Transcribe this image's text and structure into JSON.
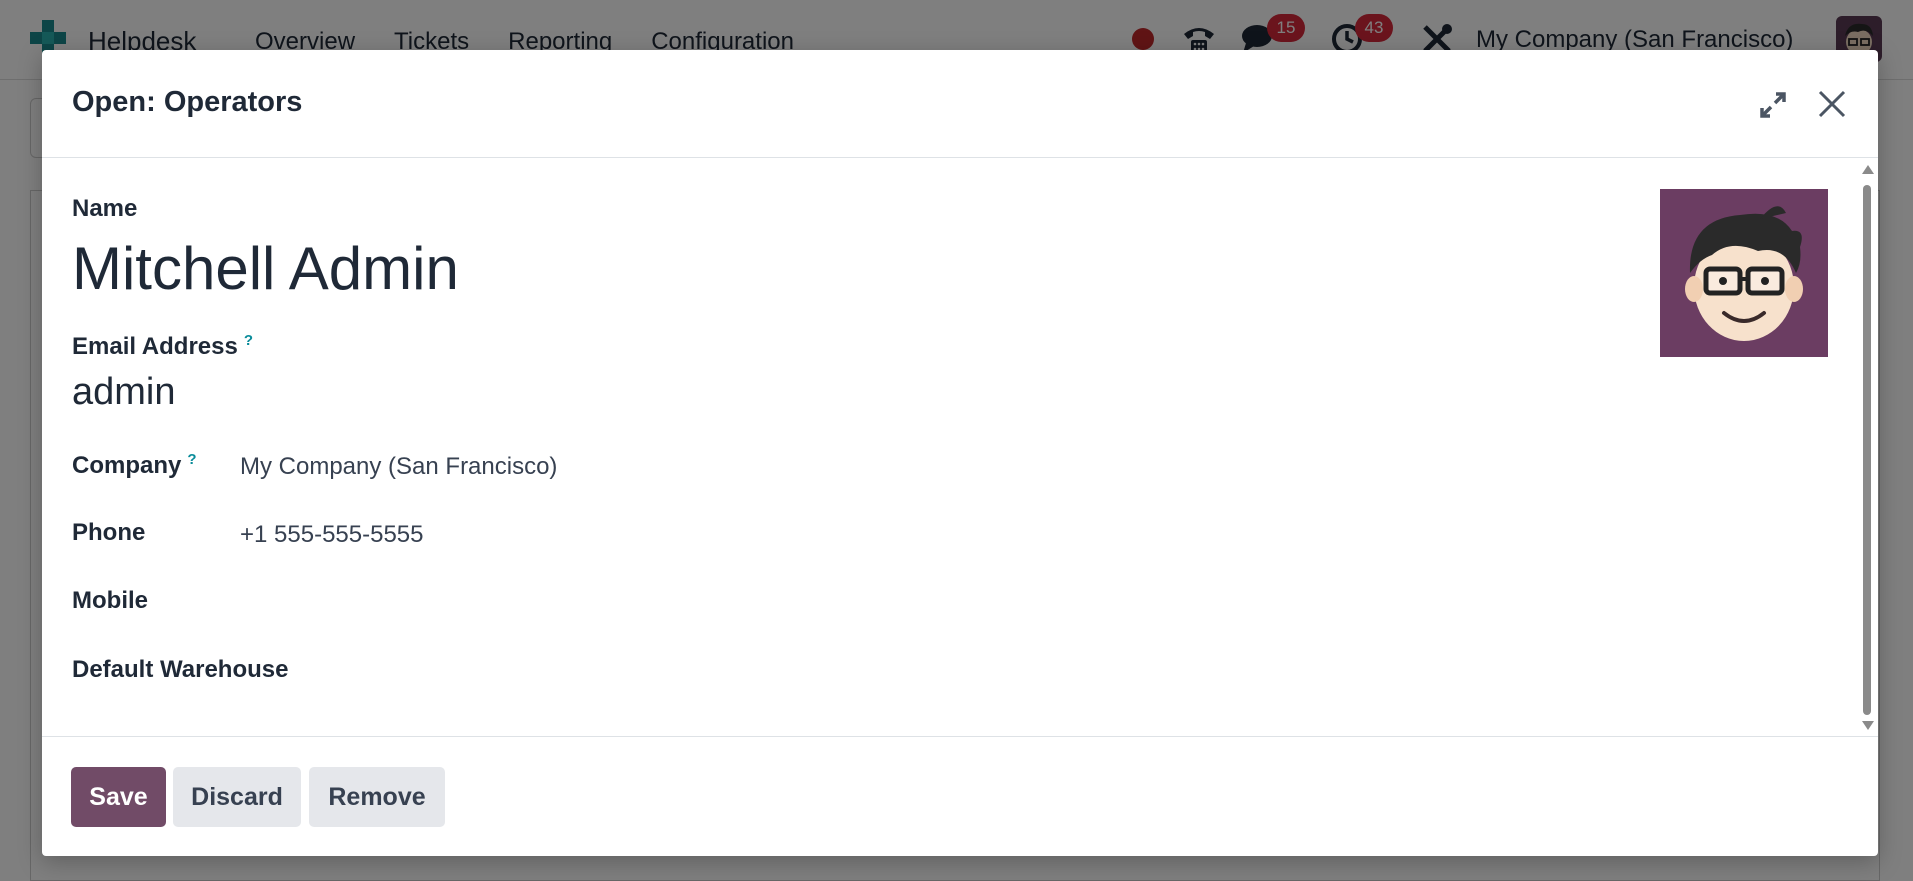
{
  "navbar": {
    "app_name": "Helpdesk",
    "menu": [
      "Overview",
      "Tickets",
      "Reporting",
      "Configuration"
    ],
    "chat_badge": "15",
    "activity_badge": "43",
    "company": "My Company (San Francisco)"
  },
  "dialog": {
    "title": "Open: Operators",
    "fields": {
      "name_label": "Name",
      "name_value": "Mitchell Admin",
      "email_label": "Email Address",
      "email_help": "?",
      "email_value": "admin",
      "company_label": "Company",
      "company_help": "?",
      "company_value": "My Company (San Francisco)",
      "phone_label": "Phone",
      "phone_value": "+1 555-555-5555",
      "mobile_label": "Mobile",
      "mobile_value": "",
      "warehouse_label": "Default Warehouse",
      "warehouse_value": ""
    },
    "buttons": {
      "save": "Save",
      "discard": "Discard",
      "remove": "Remove"
    }
  },
  "colors": {
    "primary": "#714b67",
    "badge": "#d6293b",
    "help": "#0a8c9a",
    "recording_dot": "#c0292b"
  }
}
